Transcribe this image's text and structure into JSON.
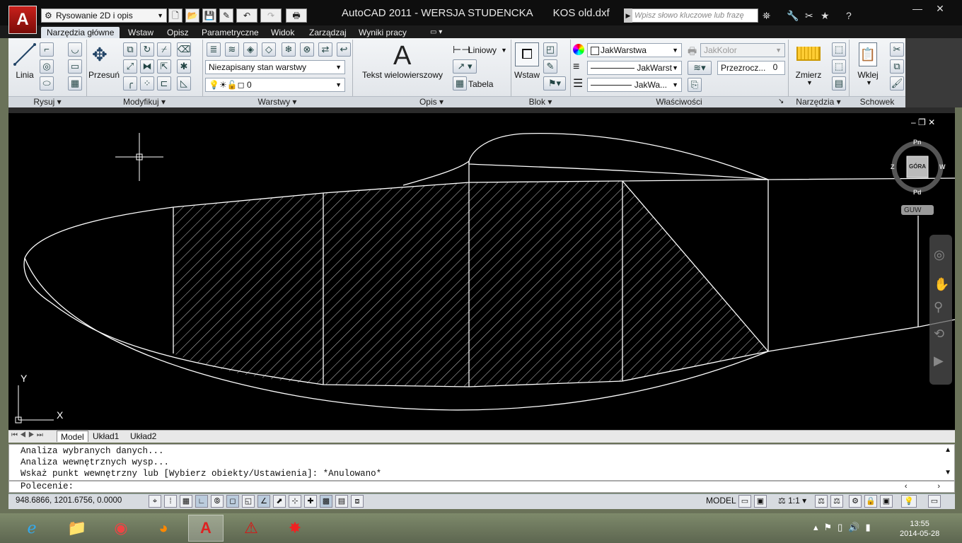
{
  "app_icon": "A",
  "workspace": "Rysowanie 2D i opis",
  "title": {
    "app": "AutoCAD 2011 - WERSJA STUDENCKA",
    "file": "KOS old.dxf"
  },
  "search_placeholder": "Wpisz słowo kluczowe lub frazę",
  "ribbon_tabs": [
    "Narzędzia główne",
    "Wstaw",
    "Opisz",
    "Parametryczne",
    "Widok",
    "Zarządzaj",
    "Wyniki pracy"
  ],
  "tools": {
    "line": "Linia",
    "move": "Przesuń",
    "mtext": "Tekst wielowierszowy",
    "linear": "Liniowy",
    "table": "Tabela",
    "insert": "Wstaw",
    "measure": "Zmierz",
    "paste": "Wklej"
  },
  "layers": {
    "state": "Niezapisany stan warstwy",
    "current": "0"
  },
  "properties": {
    "color": "JakWarstwa",
    "linetype": "JakWarst",
    "lineweight": "JakWa...",
    "plotstyle": "JakKolor",
    "transparency_label": "Przezrocz...",
    "transparency_value": "0"
  },
  "panels": {
    "draw": "Rysuj",
    "modify": "Modyfikuj",
    "layers": "Warstwy",
    "annotation": "Opis",
    "block": "Blok",
    "properties": "Właściwości",
    "utilities": "Narzędzia",
    "clipboard": "Schowek"
  },
  "viewcube": {
    "north": "Pn",
    "south": "Pd",
    "west": "Z",
    "east": "W",
    "top": "GÓRA",
    "wcs": "GUW"
  },
  "ucs": {
    "x": "X",
    "y": "Y"
  },
  "layout_tabs": [
    "Model",
    "Układ1",
    "Układ2"
  ],
  "command_history": [
    "Analiza wybranych danych...",
    "Analiza wewnętrznych wysp...",
    "Wskaż punkt wewnętrzny lub [Wybierz obiekty/Ustawienia]: *Anulowano*"
  ],
  "command_prompt": "Polecenie:",
  "status": {
    "coordinates": "948.6866, 1201.6756, 0.0000",
    "model": "MODEL",
    "scale": "1:1"
  },
  "clock": {
    "time": "13:55",
    "date": "2014-05-28"
  }
}
